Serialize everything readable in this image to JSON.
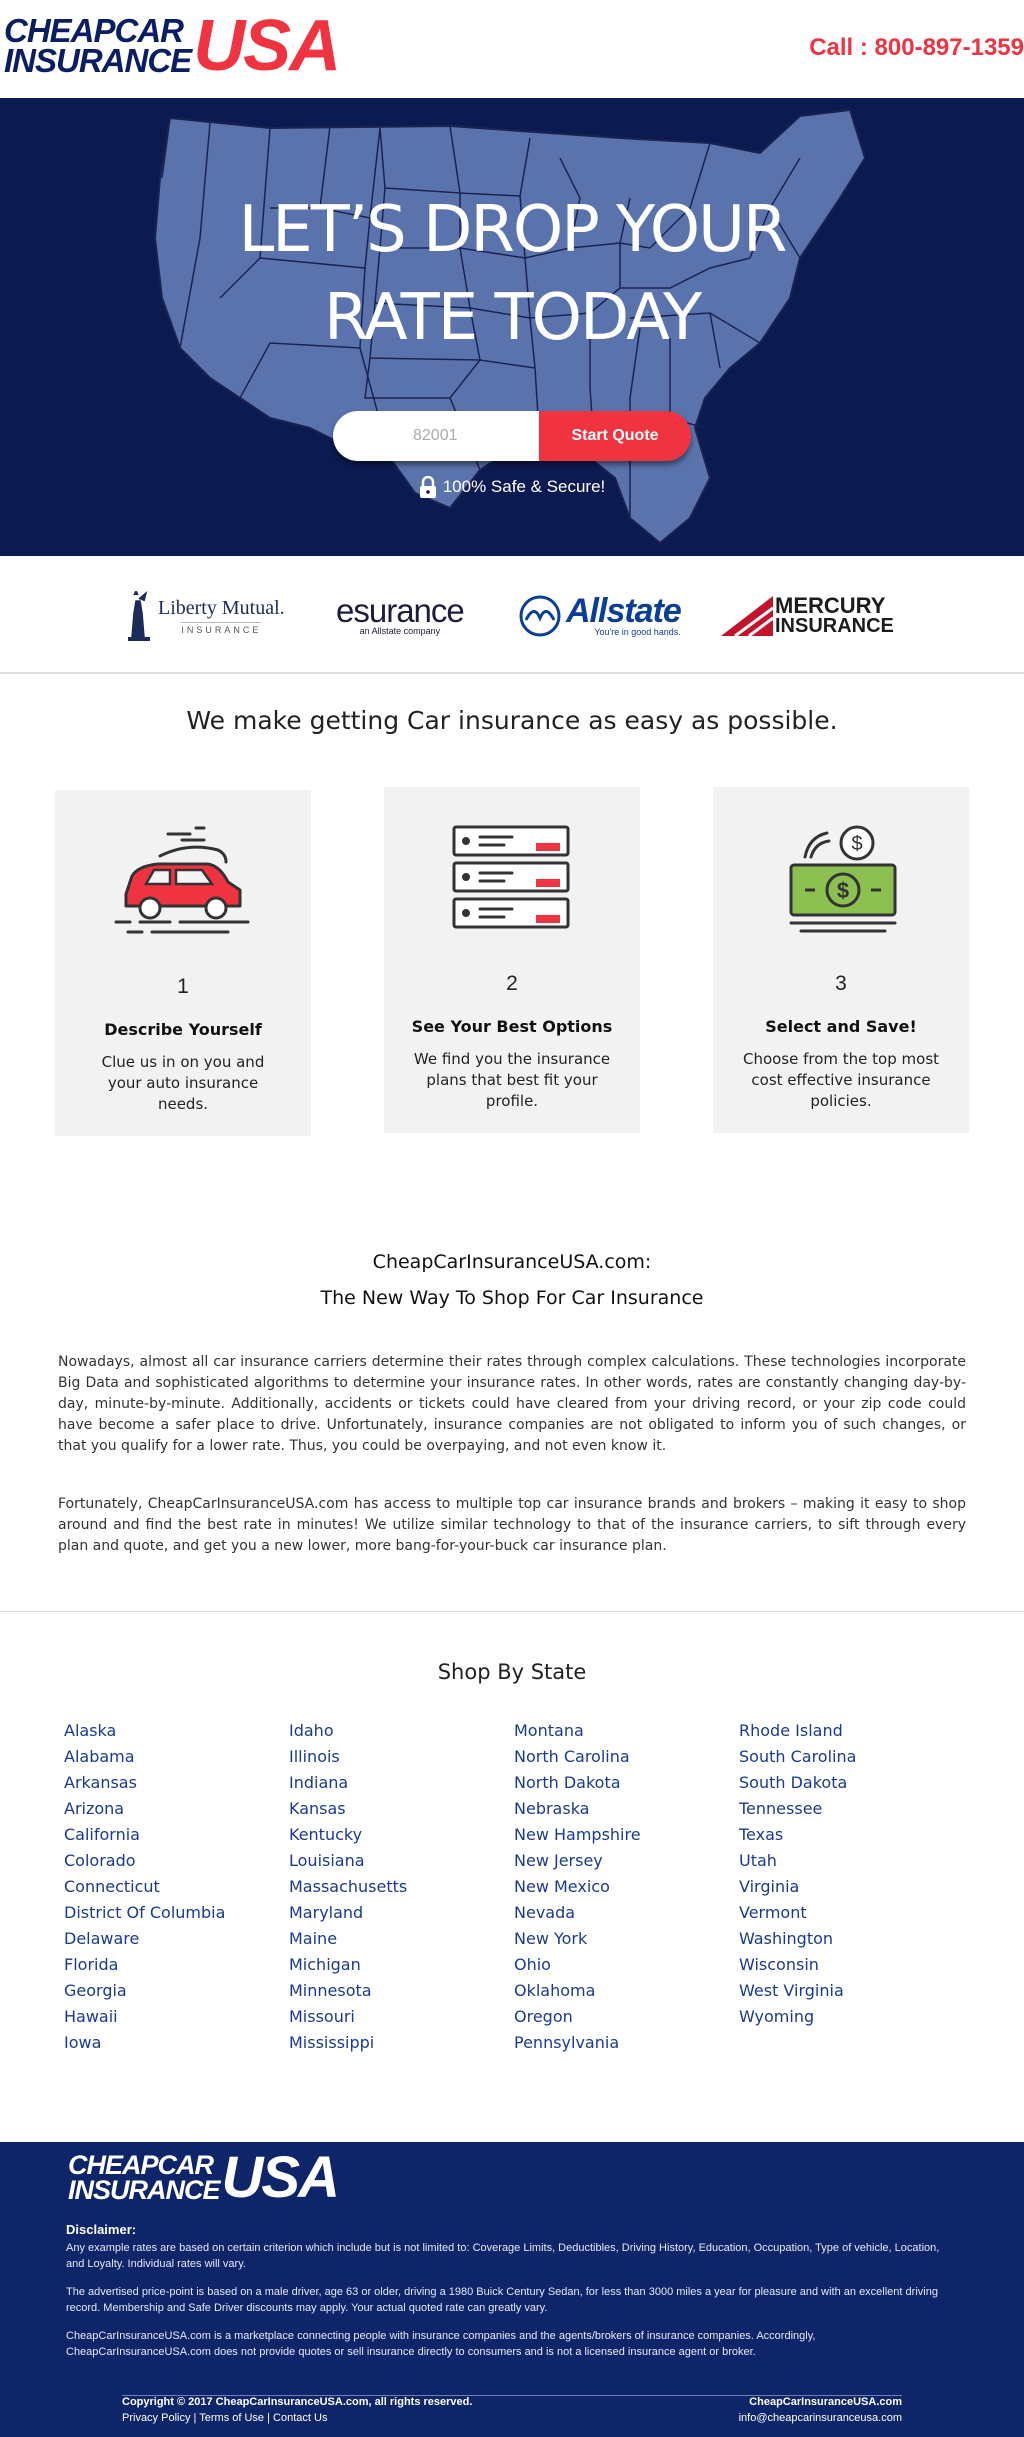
{
  "header": {
    "logo_line1": "CHEAPCAR",
    "logo_line2": "INSURANCE",
    "logo_usa": "USA",
    "call_text": "Call : 800-897-1359"
  },
  "hero": {
    "title_line1": "LET’S DROP YOUR",
    "title_line2": "RATE TODAY",
    "zip_placeholder": "82001",
    "start_button": "Start Quote",
    "secure_text": "100% Safe & Secure!"
  },
  "partners": {
    "liberty_name": "Liberty Mutual.",
    "liberty_sub": "INSURANCE",
    "esurance_name": "esurance",
    "esurance_sub": "an Allstate company",
    "allstate_name": "Allstate",
    "allstate_sub": "You're in good hands.",
    "mercury_line1": "MERCURY",
    "mercury_line2": "INSURANCE"
  },
  "steps_section": {
    "title": "We make getting Car insurance as easy as possible.",
    "steps": [
      {
        "num": "1",
        "title": "Describe Yourself",
        "desc": "Clue us in on you and your auto insurance needs."
      },
      {
        "num": "2",
        "title": "See Your Best Options",
        "desc": "We find you the insurance plans that best fit your profile."
      },
      {
        "num": "3",
        "title": "Select and Save!",
        "desc": "Choose from the top most cost effective insurance policies."
      }
    ]
  },
  "about": {
    "title_line1": "CheapCarInsuranceUSA.com:",
    "title_line2": "The New Way To Shop For Car Insurance",
    "para1": "Nowadays, almost all car insurance carriers determine their rates through complex calculations. These technologies incorporate Big Data and sophisticated algorithms to determine your insurance rates. In other words, rates are constantly changing day-by-day, minute-by-minute. Additionally, accidents or tickets could have cleared from your driving record, or your zip code could have become a safer place to drive. Unfortunately, insurance companies are not obligated to inform you of such changes, or that you qualify for a lower rate. Thus, you could be overpaying, and not even know it.",
    "para2": "Fortunately, CheapCarInsuranceUSA.com has access to multiple top car insurance brands and brokers – making it easy to shop around and find the best rate in minutes! We utilize similar technology to that of the insurance carriers, to sift through every plan and quote, and get you a new lower, more bang-for-your-buck car insurance plan."
  },
  "states": {
    "title": "Shop By State",
    "columns": [
      [
        "Alaska",
        "Alabama",
        "Arkansas",
        "Arizona",
        "California",
        "Colorado",
        "Connecticut",
        "District Of Columbia",
        "Delaware",
        "Florida",
        "Georgia",
        "Hawaii",
        "Iowa"
      ],
      [
        "Idaho",
        "Illinois",
        "Indiana",
        "Kansas",
        "Kentucky",
        "Louisiana",
        "Massachusetts",
        "Maryland",
        "Maine",
        "Michigan",
        "Minnesota",
        "Missouri",
        "Mississippi"
      ],
      [
        "Montana",
        "North Carolina",
        "North Dakota",
        "Nebraska",
        "New Hampshire",
        "New Jersey",
        "New Mexico",
        "Nevada",
        "New York",
        "Ohio",
        "Oklahoma",
        "Oregon",
        "Pennsylvania"
      ],
      [
        "Rhode Island",
        "South Carolina",
        "South Dakota",
        "Tennessee",
        "Texas",
        "Utah",
        "Virginia",
        "Vermont",
        "Washington",
        "Wisconsin",
        "West Virginia",
        "Wyoming"
      ]
    ]
  },
  "footer": {
    "logo_line1": "CHEAPCAR",
    "logo_line2": "INSURANCE",
    "logo_usa": "USA",
    "disclaimer_title": "Disclaimer:",
    "disclaimer1": "Any example rates are based on certain criterion which include but is not limited to: Coverage Limits, Deductibles, Driving History, Education, Occupation, Type of vehicle, Location, and Loyalty. Individual rates will vary.",
    "disclaimer2": "The advertised price-point is based on a male driver, age 63 or older, driving a 1980 Buick Century Sedan, for less than 3000 miles a year for pleasure and with an excellent driving record. Membership and Safe Driver discounts may apply. Your actual quoted rate can greatly vary.",
    "disclaimer3": "CheapCarInsuranceUSA.com is a marketplace connecting people with insurance companies and the agents/brokers of insurance companies. Accordingly, CheapCarInsuranceUSA.com does not provide quotes or sell insurance directly to consumers and is not a licensed insurance agent or broker.",
    "copyright": "Copyright © 2017 CheapCarInsuranceUSA.com, all rights reserved.",
    "privacy": "Privacy Policy",
    "sep1": " | ",
    "terms": "Terms of Use",
    "sep2": " | ",
    "contact": "Contact Us",
    "site": "CheapCarInsuranceUSA.com",
    "email": "info@cheapcarinsuranceusa.com"
  },
  "colors": {
    "navy": "#0c1a52",
    "footer_navy": "#0e2669",
    "accent_red": "#ef3340",
    "map_blue": "#5b73ad",
    "link_blue": "#1a3a8f"
  }
}
